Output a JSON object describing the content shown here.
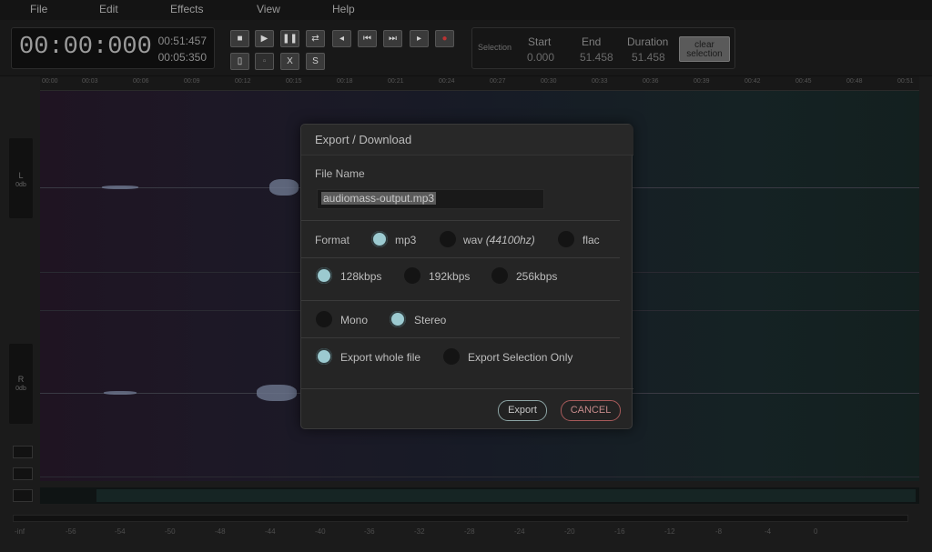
{
  "menu": {
    "items": [
      "File",
      "Edit",
      "Effects",
      "View",
      "Help"
    ]
  },
  "toolbar": {
    "time_main": "00:00:000",
    "time_total": "00:51:457",
    "time_selected": "00:05:350",
    "transport_icons": [
      "stop-icon",
      "play-icon",
      "pause-icon",
      "loop-icon",
      "skip-back-icon",
      "step-back-icon",
      "step-forward-icon",
      "skip-forward-icon",
      "record-icon"
    ],
    "edit_icons": [
      "new-file-icon",
      "copy-icon",
      "cut-icon",
      "split-icon"
    ],
    "edit_labels": [
      "",
      "",
      "X",
      "S"
    ]
  },
  "selection": {
    "label": "Selection",
    "start_label": "Start",
    "start_value": "0.000",
    "end_label": "End",
    "end_value": "51.458",
    "duration_label": "Duration",
    "duration_value": "51.458",
    "clear_label": "clear selection"
  },
  "tracks": {
    "left_label": "L",
    "right_label": "R",
    "db_label": "0db"
  },
  "meter_labels": [
    "-inf",
    "-56",
    "-54",
    "-50",
    "-48",
    "-44",
    "-40",
    "-36",
    "-32",
    "-28",
    "-24",
    "-20",
    "-16",
    "-12",
    "-8",
    "-4",
    "0"
  ],
  "ruler_labels": [
    "00:00",
    "00:03",
    "00:06",
    "00:09",
    "00:12",
    "00:15",
    "00:18",
    "00:21",
    "00:24",
    "00:27",
    "00:30",
    "00:33",
    "00:36",
    "00:39",
    "00:42",
    "00:45",
    "00:48",
    "00:51"
  ],
  "dialog": {
    "title": "Export / Download",
    "file_name_label": "File Name",
    "file_name_value": "audiomass-output.mp3",
    "format_label": "Format",
    "format_mp3": "mp3",
    "format_wav": "wav",
    "format_wav_note": "(44100hz)",
    "format_flac": "flac",
    "bitrate_128": "128kbps",
    "bitrate_192": "192kbps",
    "bitrate_256": "256kbps",
    "mono": "Mono",
    "stereo": "Stereo",
    "export_whole": "Export whole file",
    "export_selection": "Export Selection Only",
    "export_button": "Export",
    "cancel_button": "CANCEL"
  },
  "colors": {
    "radio_on": "#9ccad0",
    "cancel_border": "#a75a5a",
    "export_border": "#8ca4a4"
  }
}
